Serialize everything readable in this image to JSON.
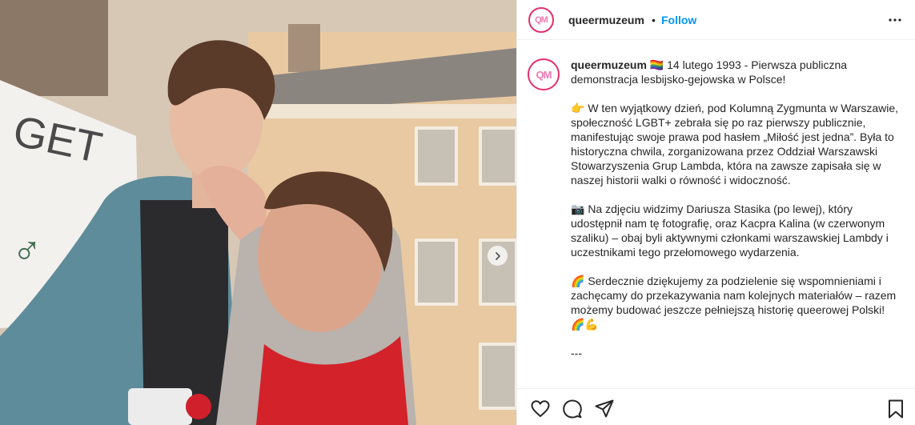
{
  "post": {
    "image_alt": "Two men at a 1993 demonstration in Warsaw",
    "next_icon": "chevron-right-icon"
  },
  "header": {
    "avatar_text": "QM",
    "username": "queermuzeum",
    "separator": "•",
    "follow_label": "Follow",
    "more_icon": "more-horizontal-icon"
  },
  "caption": {
    "avatar_text": "QM",
    "username": "queermuzeum",
    "intro": " 🏳️‍🌈 14 lutego 1993 - Pierwsza publiczna demonstracja lesbijsko-gejowska w Polsce!",
    "para1": "👉 W ten wyjątkowy dzień, pod Kolumną Zygmunta w Warszawie, społeczność LGBT+ zebrała się po raz pierwszy publicznie, manifestując swoje prawa pod hasłem „Miłość jest jedna”. Była to historyczna chwila, zorganizowana przez Oddział Warszawski Stowarzyszenia Grup Lambda, która na zawsze zapisała się w naszej historii walki o równość i widoczność.",
    "para2": "📷 Na zdjęciu widzimy Dariusza Stasika (po lewej), który udostępnił nam tę fotografię, oraz Kacpra Kalina (w czerwonym szaliku) – obaj byli aktywnymi członkami warszawskiej Lambdy i uczestnikami tego przełomowego wydarzenia.",
    "para3": "🌈 Serdecznie dziękujemy za podzielenie się wspomnieniami i zachęcamy do przekazywania nam kolejnych materiałów – razem możemy budować jeszcze pełniejszą historię queerowej Polski! 🌈💪",
    "separator_line": "---"
  },
  "actions": {
    "like_icon": "heart-icon",
    "comment_icon": "comment-icon",
    "share_icon": "send-icon",
    "save_icon": "bookmark-icon"
  },
  "colors": {
    "follow": "#0095f6",
    "avatar_ring": "#e1306c",
    "text": "#262626",
    "divider": "#efefef"
  }
}
